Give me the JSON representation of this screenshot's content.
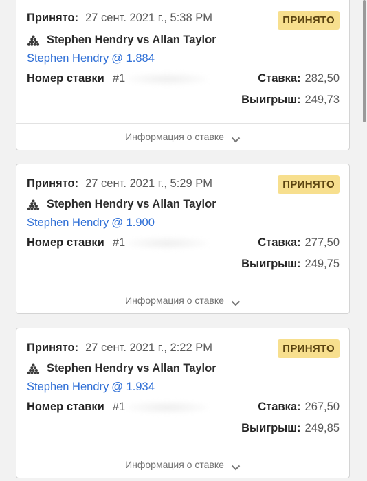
{
  "bets": [
    {
      "accepted_label": "Принято:",
      "accepted_at": "27 сент. 2021 г., 5:38 PM",
      "status": "ПРИНЯТО",
      "sport_icon": "snooker-balls-icon",
      "match": "Stephen Hendry vs Allan Taylor",
      "pick_name": "Stephen Hendry",
      "pick_odds": "@ 1.884",
      "bet_number_label": "Номер ставки",
      "bet_number_prefix": "#1",
      "stake_label": "Ставка:",
      "stake": "282,50",
      "payout_label": "Выигрыш:",
      "payout": "249,73",
      "info_label": "Информация о ставке"
    },
    {
      "accepted_label": "Принято:",
      "accepted_at": "27 сент. 2021 г., 5:29 PM",
      "status": "ПРИНЯТО",
      "sport_icon": "snooker-balls-icon",
      "match": "Stephen Hendry vs Allan Taylor",
      "pick_name": "Stephen Hendry",
      "pick_odds": "@ 1.900",
      "bet_number_label": "Номер ставки",
      "bet_number_prefix": "#1",
      "stake_label": "Ставка:",
      "stake": "277,50",
      "payout_label": "Выигрыш:",
      "payout": "249,75",
      "info_label": "Информация о ставке"
    },
    {
      "accepted_label": "Принято:",
      "accepted_at": "27 сент. 2021 г., 2:22 PM",
      "status": "ПРИНЯТО",
      "sport_icon": "snooker-balls-icon",
      "match": "Stephen Hendry vs Allan Taylor",
      "pick_name": "Stephen Hendry",
      "pick_odds": "@ 1.934",
      "bet_number_label": "Номер ставки",
      "bet_number_prefix": "#1",
      "stake_label": "Ставка:",
      "stake": "267,50",
      "payout_label": "Выигрыш:",
      "payout": "249,85",
      "info_label": "Информация о ставке"
    }
  ],
  "colors": {
    "badge_bg": "#f7df8e",
    "pick_link": "#2f6fd6",
    "page_bg": "#f2f2f2"
  }
}
